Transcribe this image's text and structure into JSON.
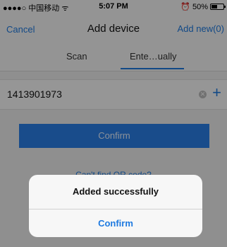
{
  "status_bar": {
    "carrier": "●●●●○ 中国移动 ᯤ",
    "time": "5:07 PM",
    "battery": "50%",
    "battery_level": 0.5
  },
  "nav": {
    "cancel_label": "Cancel",
    "title": "Add device",
    "add_new_label": "Add new(0)"
  },
  "tabs": {
    "scan_label": "Scan",
    "enter_label": "Ente…ually",
    "selected": "enter"
  },
  "form": {
    "device_id_value": "1413901973"
  },
  "confirm_button_label": "Confirm",
  "help_link_label": "Can't find QR code?",
  "alert": {
    "title": "Added successfully",
    "confirm_label": "Confirm"
  },
  "colors": {
    "accent": "#1e7ae0",
    "button": "#2a7fe8"
  }
}
